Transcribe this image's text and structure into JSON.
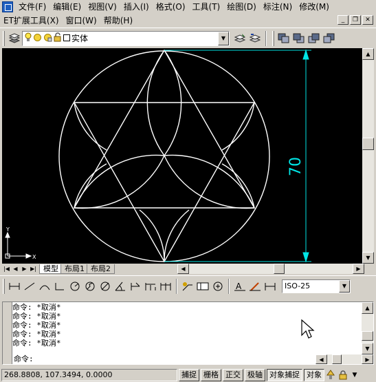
{
  "menu": {
    "row1": [
      "文件(F)",
      "编辑(E)",
      "视图(V)",
      "插入(I)",
      "格式(O)",
      "工具(T)",
      "绘图(D)",
      "标注(N)",
      "修改(M)"
    ],
    "row2": [
      "ET扩展工具(X)",
      "窗口(W)",
      "帮助(H)"
    ]
  },
  "toolbar": {
    "layer_value": "实体"
  },
  "drawing": {
    "dimension_text": "70",
    "ucs_x": "X",
    "ucs_y": "Y",
    "colors": {
      "background": "#000000",
      "geometry": "#ffffff",
      "dimension": "#00e5e5"
    }
  },
  "layout_tabs": [
    "模型",
    "布局1",
    "布局2"
  ],
  "dim_toolbar": {
    "style_value": "ISO-25"
  },
  "command": {
    "history": [
      "命令: *取消*",
      "命令: *取消*",
      "命令: *取消*",
      "命令: *取消*",
      "命令: *取消*"
    ],
    "prompt": "命令:"
  },
  "status": {
    "coordinates": "268.8808, 107.3494, 0.0000",
    "buttons": [
      "捕捉",
      "栅格",
      "正交",
      "极轴",
      "对象捕捉",
      "对象"
    ]
  }
}
